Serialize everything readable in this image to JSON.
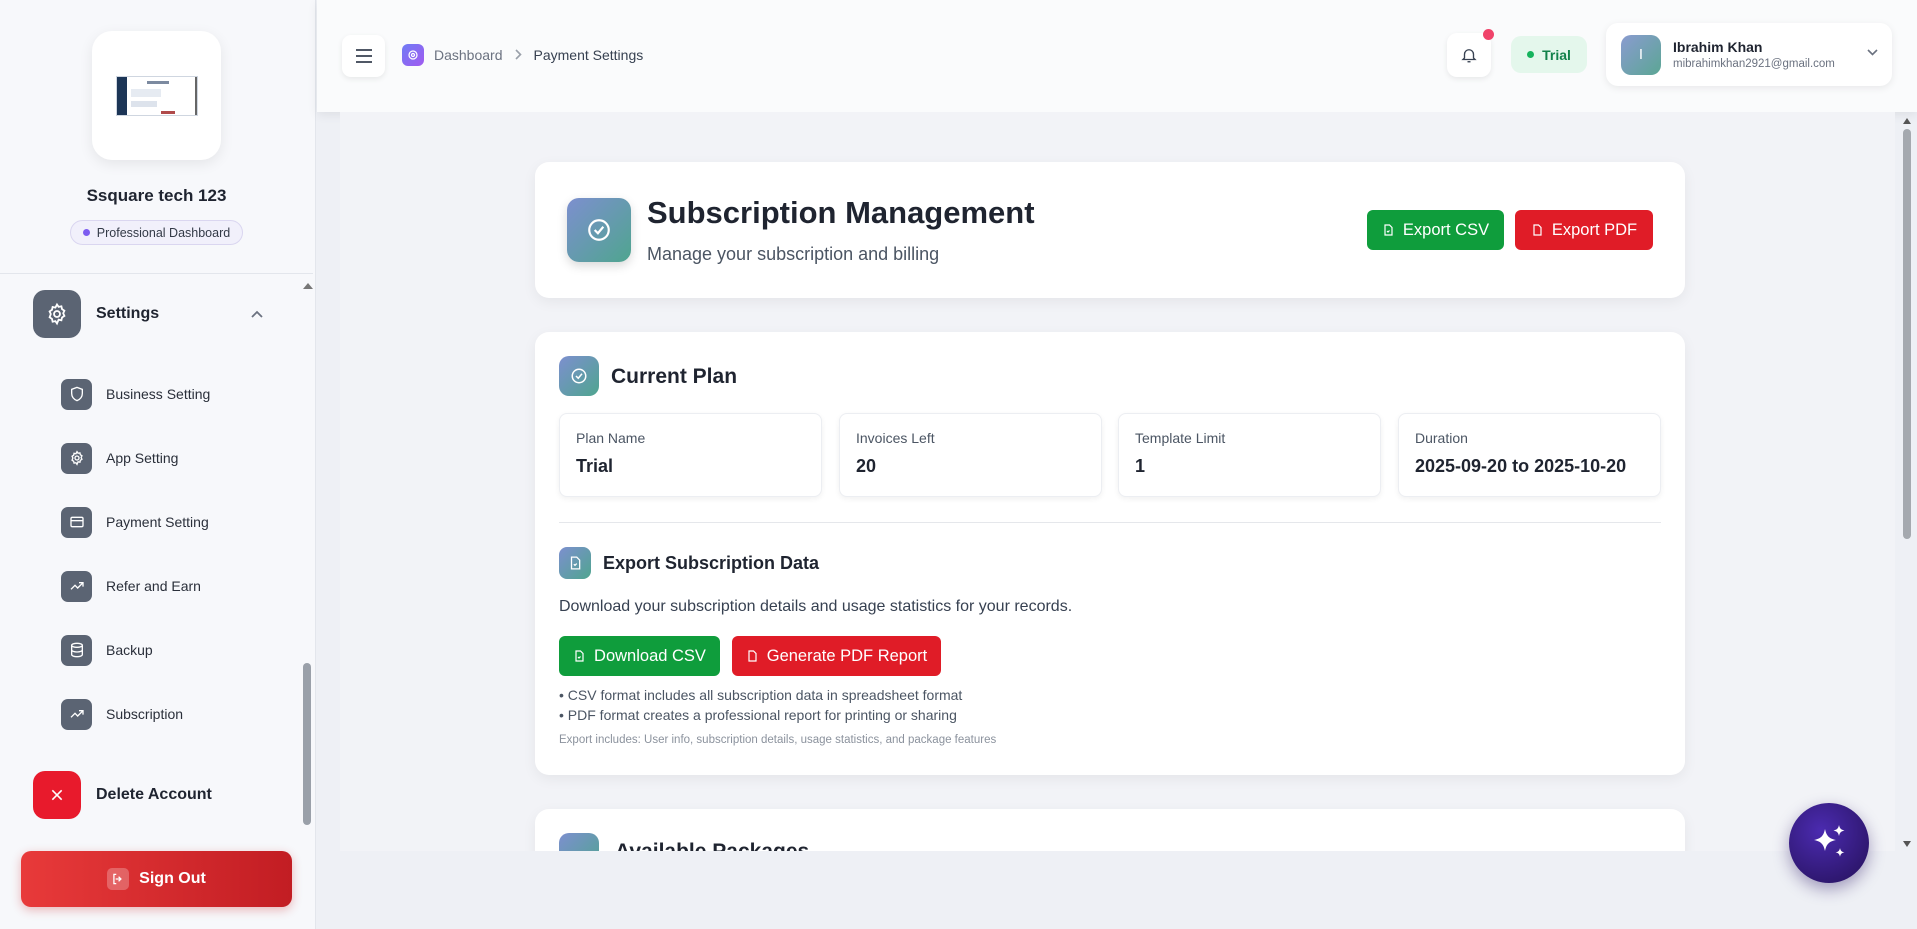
{
  "sidebar": {
    "company_name": "Ssquare tech 123",
    "dashboard_badge": "Professional Dashboard",
    "settings_label": "Settings",
    "items": [
      {
        "label": "Business Setting",
        "icon": "shield-icon"
      },
      {
        "label": "App Setting",
        "icon": "gear-icon"
      },
      {
        "label": "Payment Setting",
        "icon": "credit-card-icon"
      },
      {
        "label": "Refer and Earn",
        "icon": "trending-up-icon"
      },
      {
        "label": "Backup",
        "icon": "database-icon"
      },
      {
        "label": "Subscription",
        "icon": "trending-up-icon"
      }
    ],
    "delete_label": "Delete Account",
    "signout_label": "Sign Out"
  },
  "topbar": {
    "breadcrumb_home": "Dashboard",
    "breadcrumb_current": "Payment Settings",
    "plan_status": "Trial",
    "user_initial": "I",
    "user_name": "Ibrahim Khan",
    "user_email": "mibrahimkhan2921@gmail.com"
  },
  "header": {
    "title": "Subscription Management",
    "subtitle": "Manage your subscription and billing",
    "export_csv": "Export CSV",
    "export_pdf": "Export PDF"
  },
  "current_plan": {
    "title": "Current Plan",
    "stats": [
      {
        "label": "Plan Name",
        "value": "Trial"
      },
      {
        "label": "Invoices Left",
        "value": "20"
      },
      {
        "label": "Template Limit",
        "value": "1"
      },
      {
        "label": "Duration",
        "value": "2025-09-20 to 2025-10-20"
      }
    ]
  },
  "export_section": {
    "title": "Export Subscription Data",
    "description": "Download your subscription details and usage statistics for your records.",
    "download_csv": "Download CSV",
    "generate_pdf": "Generate PDF Report",
    "bullets": [
      "• CSV format includes all subscription data in spreadsheet format",
      "• PDF format creates a professional report for printing or sharing"
    ],
    "note": "Export includes: User info, subscription details, usage statistics, and package features"
  },
  "packages": {
    "title": "Available Packages"
  },
  "colors": {
    "accent_green": "#0f9d3c",
    "accent_red": "#e01c27",
    "trial_green": "#12824b"
  }
}
